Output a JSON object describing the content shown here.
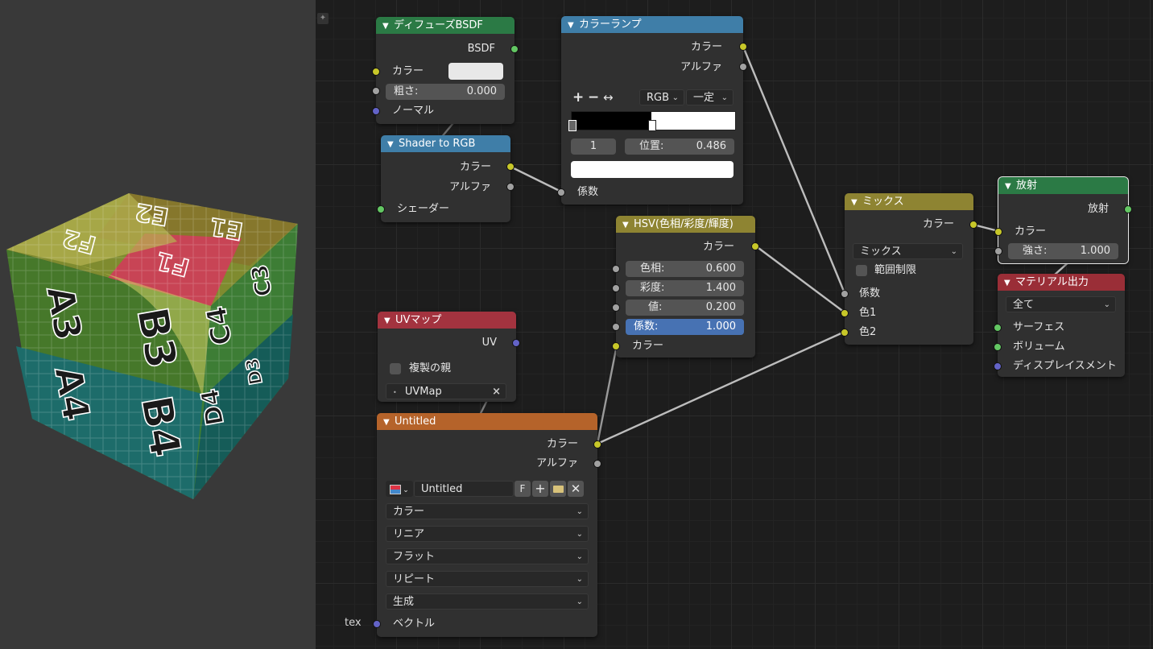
{
  "viewport": {
    "faces": {
      "top": [
        "E2",
        "E1",
        "F2",
        "F1"
      ],
      "left": [
        "A3",
        "A4"
      ],
      "front": [
        "B3",
        "B4",
        "C4",
        "D4"
      ],
      "right": [
        "C3",
        "D3"
      ]
    }
  },
  "diffuse": {
    "title": "ディフューズBSDF",
    "out_bsdf": "BSDF",
    "color": "カラー",
    "rough_label": "粗さ:",
    "rough_value": "0.000",
    "normal": "ノーマル",
    "color_hex": "#e8e8e8"
  },
  "shader_rgb": {
    "title": "Shader to RGB",
    "out_color": "カラー",
    "out_alpha": "アルファ",
    "in_shader": "シェーダー"
  },
  "ramp": {
    "title": "カラーランプ",
    "out_color": "カラー",
    "out_alpha": "アルファ",
    "plus": "+",
    "minus": "−",
    "flip": "↔",
    "mode": "RGB",
    "interp": "一定",
    "index": "1",
    "pos_label": "位置:",
    "pos_value": "0.486",
    "in_fac": "係数",
    "stop_pos": 0.486
  },
  "hsv": {
    "title": "HSV(色相/彩度/輝度)",
    "out_color": "カラー",
    "hue_label": "色相:",
    "hue_value": "0.600",
    "sat_label": "彩度:",
    "sat_value": "1.400",
    "val_label": "値:",
    "val_value": "0.200",
    "fac_label": "係数:",
    "fac_value": "1.000",
    "in_color": "カラー"
  },
  "mix": {
    "title": "ミックス",
    "out_color": "カラー",
    "blend": "ミックス",
    "clamp": "範囲制限",
    "fac": "係数",
    "color1": "色1",
    "color2": "色2"
  },
  "emission": {
    "title": "放射",
    "out": "放射",
    "color": "カラー",
    "strength_label": "強さ:",
    "strength_value": "1.000"
  },
  "output": {
    "title": "マテリアル出力",
    "target": "全て",
    "surface": "サーフェス",
    "volume": "ボリューム",
    "displacement": "ディスプレイスメント"
  },
  "uvmap": {
    "title": "UVマップ",
    "out_uv": "UV",
    "from_instancer": "複製の親",
    "map_name": "UVMap",
    "clear": "×"
  },
  "image": {
    "title": "Untitled",
    "out_color": "カラー",
    "out_alpha": "アルファ",
    "image_name": "Untitled",
    "fake": "F",
    "color_space": "カラー",
    "interpolation": "リニア",
    "projection": "フラット",
    "extension": "リピート",
    "source": "生成",
    "in_vector": "ベクトル"
  },
  "frame_label": "tex"
}
